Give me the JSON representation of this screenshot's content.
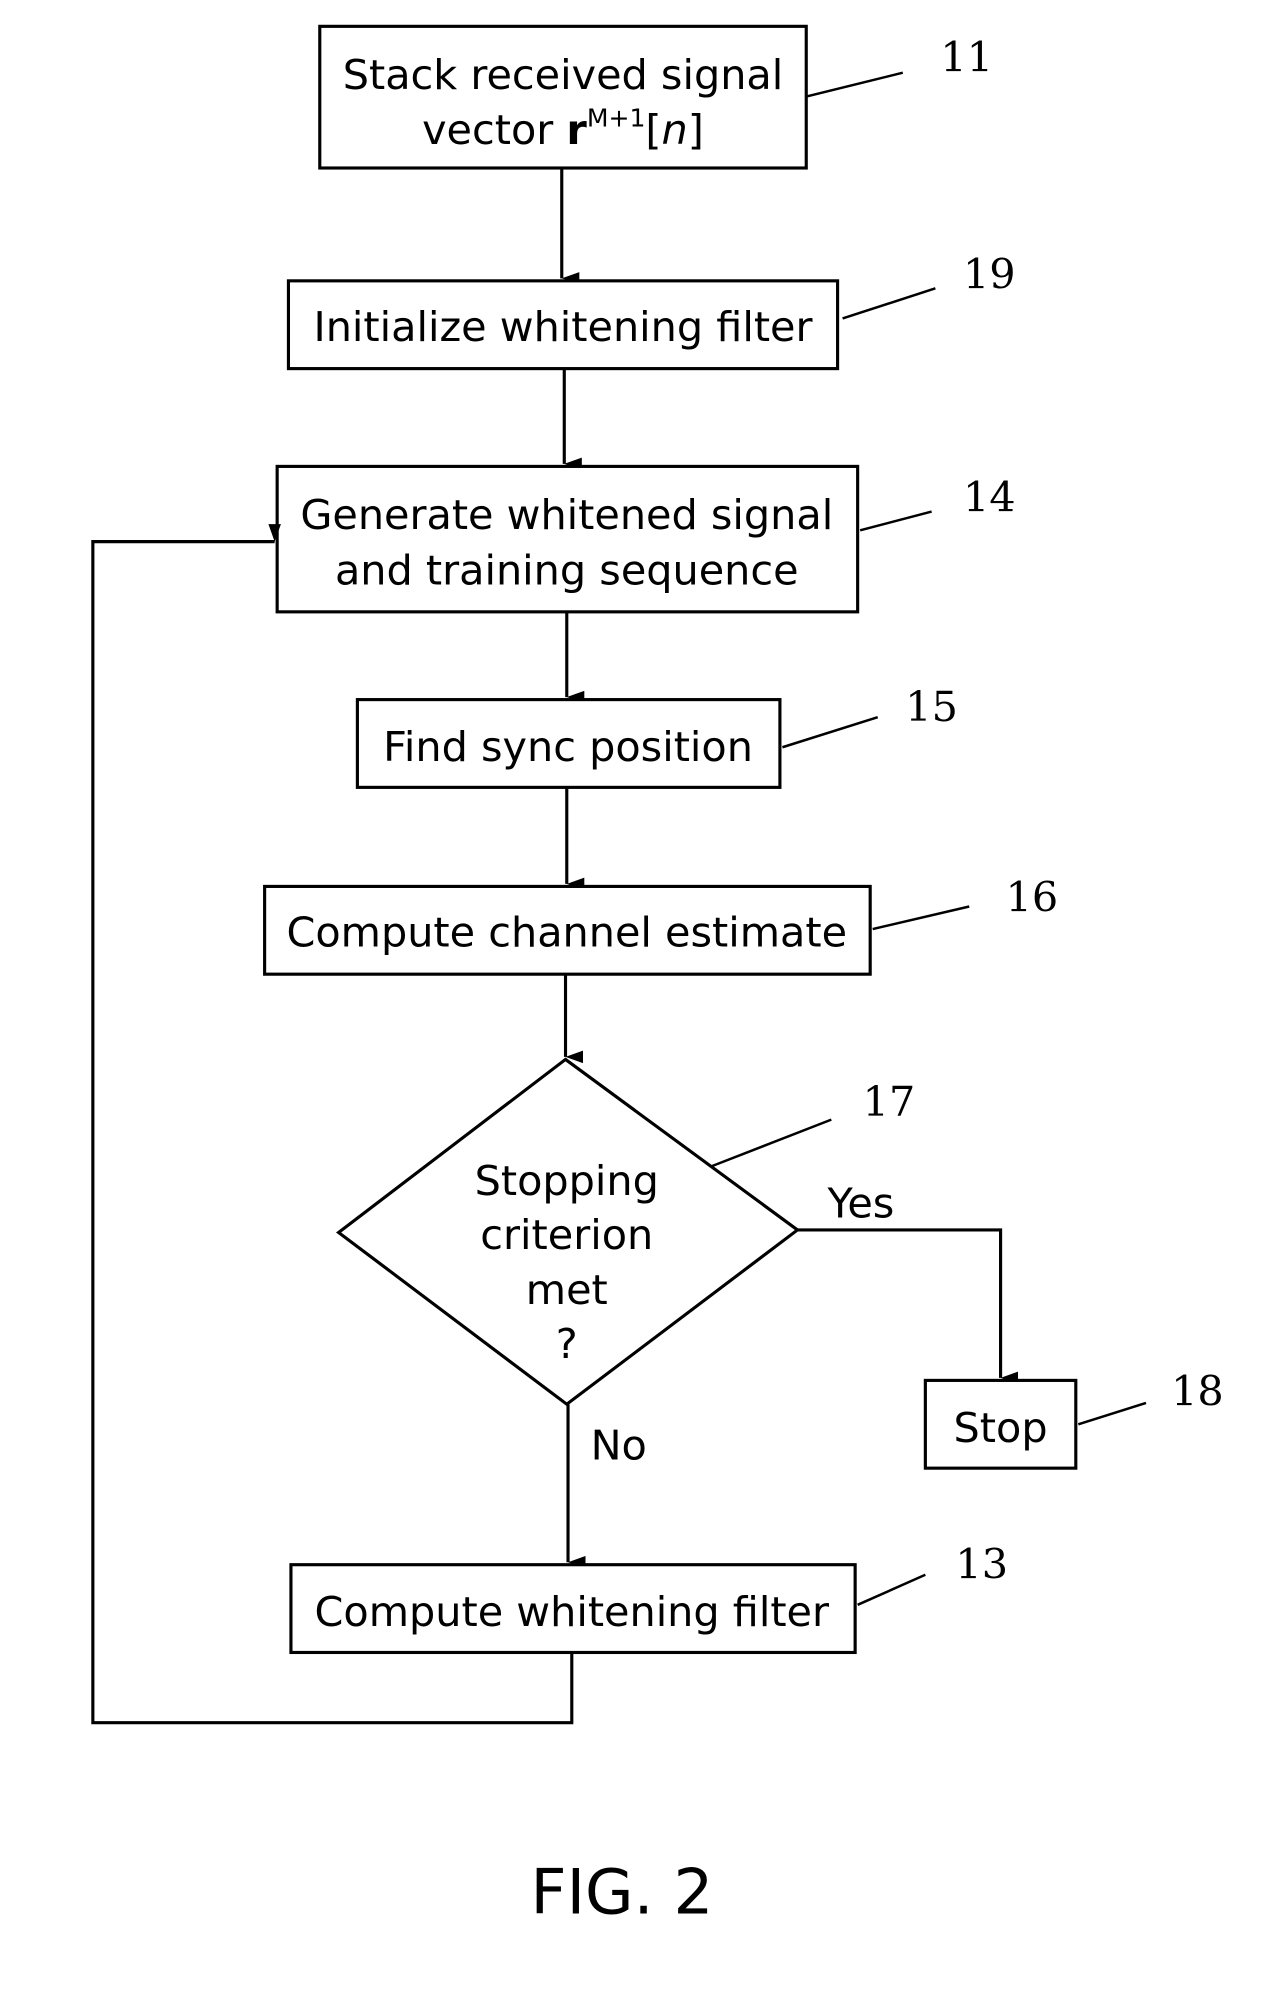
{
  "figure_label": "FIG. 2",
  "steps": {
    "s11": {
      "ref": "11",
      "line1": "Stack received signal",
      "line2_prefix": "vector ",
      "line2_symbol": "r",
      "line2_sup": "M+1",
      "line2_open": "[",
      "line2_var": "n",
      "line2_close": "]"
    },
    "s19": {
      "ref": "19",
      "text": "Initialize whitening filter"
    },
    "s14": {
      "ref": "14",
      "line1": "Generate whitened signal",
      "line2": "and training sequence"
    },
    "s15": {
      "ref": "15",
      "text": "Find sync position"
    },
    "s16": {
      "ref": "16",
      "text": "Compute channel estimate"
    },
    "s17": {
      "ref": "17",
      "line1": "Stopping",
      "line2": "criterion",
      "line3": "met",
      "line4": "?"
    },
    "s18": {
      "ref": "18",
      "text": "Stop"
    },
    "s13": {
      "ref": "13",
      "text": "Compute whitening filter"
    }
  },
  "branches": {
    "yes": "Yes",
    "no": "No"
  }
}
